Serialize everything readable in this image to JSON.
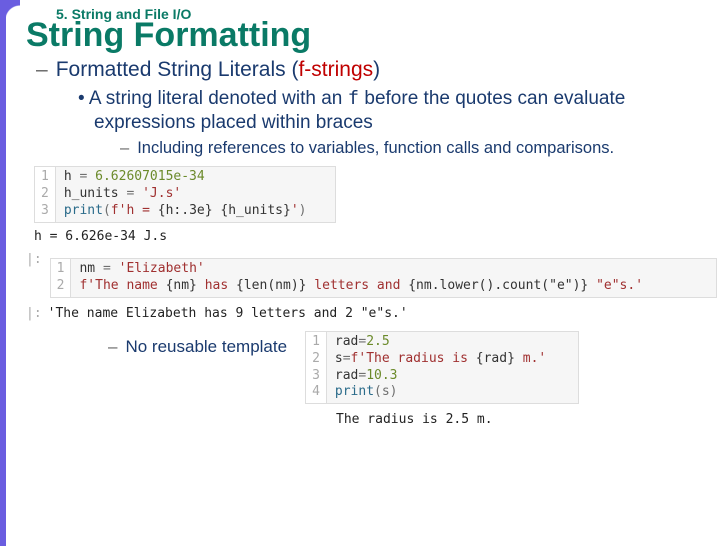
{
  "chapter": "5. String and File I/O",
  "title": "String Formatting",
  "bullet1_a": "Formatted String Literals (",
  "bullet1_f": "f-strings",
  "bullet1_b": ")",
  "bullet2_a": "A string literal denoted with an ",
  "bullet2_f": "f",
  "bullet2_b": " before the quotes can evaluate expressions placed within braces",
  "bullet3": "Including references to variables, function calls and comparisons.",
  "bullet4": "No reusable template",
  "code1": {
    "gutter": "1\n2\n3",
    "l1_a": "h ",
    "l1_b": "= ",
    "l1_c": "6.62607015e-34",
    "l2_a": "h_units ",
    "l2_b": "= ",
    "l2_c": "'J.s'",
    "l3_a": "print",
    "l3_b": "(",
    "l3_c": "f'h = ",
    "l3_d": "{h:.3e}",
    "l3_e": " ",
    "l3_f": "{h_units}",
    "l3_g": "'",
    "l3_h": ")"
  },
  "output1": "h = 6.626e-34 J.s",
  "prompt2": "|:",
  "code2": {
    "gutter": "1\n2",
    "l1_a": "nm ",
    "l1_b": "= ",
    "l1_c": "'Elizabeth'",
    "l2_a": "f'The name ",
    "l2_b": "{nm}",
    "l2_c": " has ",
    "l2_d": "{len(nm)}",
    "l2_e": " letters and ",
    "l2_f": "{nm.lower().count(\"e\")}",
    "l2_g": " \"e\"s.'"
  },
  "output2_prompt": "|:",
  "output2": "'The name Elizabeth has 9 letters and 2 \"e\"s.'",
  "code3": {
    "gutter": "1\n2\n3\n4",
    "l1_a": "rad",
    "l1_b": "=",
    "l1_c": "2.5",
    "l2_a": "s",
    "l2_b": "=",
    "l2_c": "f'The radius is ",
    "l2_d": "{rad}",
    "l2_e": " m.'",
    "l3_a": "rad",
    "l3_b": "=",
    "l3_c": "10.3",
    "l4_a": "print",
    "l4_b": "(s)"
  },
  "output3": "The radius is 2.5 m."
}
